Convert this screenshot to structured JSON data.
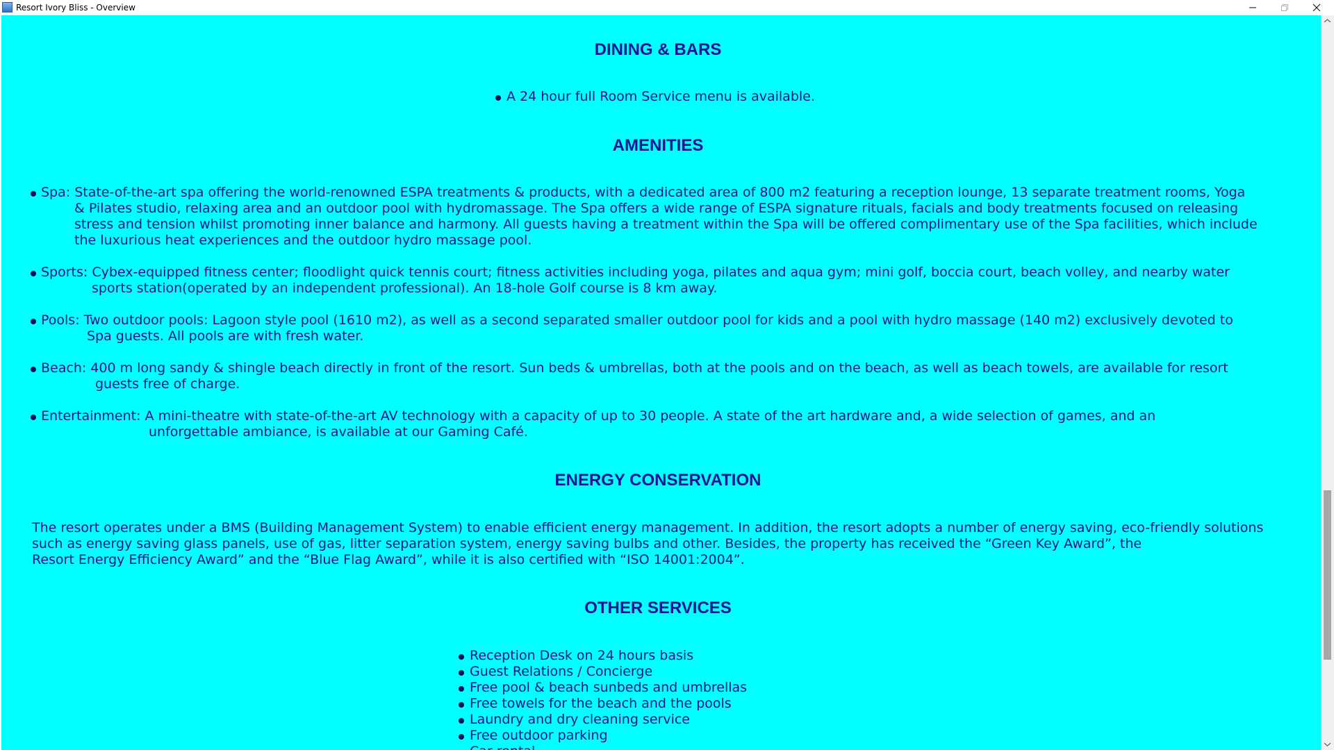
{
  "window": {
    "title": "Resort Ivory Bliss - Overview",
    "background": "#00ffff",
    "text_color": "#1a1a8c"
  },
  "sections": {
    "dining": {
      "heading": "DINING & BARS",
      "item": "A 24 hour full Room Service menu is available."
    },
    "amenities": {
      "heading": "AMENITIES",
      "items": [
        {
          "line1": "Spa: State-of-the-art spa offering the world-renowned ESPA treatments & products, with a dedicated area of 800 m2 featuring a reception lounge, 13 separate treatment rooms, Yoga",
          "line2": "& Pilates studio, relaxing area and an outdoor pool with hydromassage. The Spa offers a wide range of ESPA signature rituals, facials and body treatments focused on releasing",
          "line3": "stress and tension whilst promoting inner balance and harmony. All guests having a treatment within the Spa will be offered complimentary use of the Spa facilities, which include",
          "line4": "the luxurious heat experiences and the outdoor hydro massage pool."
        },
        {
          "line1": "Sports: Cybex-equipped fitness center; floodlight quick tennis court; fitness activities including yoga, pilates and aqua gym; mini golf, boccia court, beach volley, and nearby water",
          "line2": "sports station(operated by an independent professional). An 18-hole Golf course is 8 km away."
        },
        {
          "line1": "Pools: Two outdoor pools: Lagoon style pool (1610 m2), as well as a second separated smaller outdoor pool for kids and a pool with hydro massage (140 m2) exclusively devoted to",
          "line2": "Spa guests. All pools are with fresh water."
        },
        {
          "line1": "Beach: 400 m long sandy & shingle beach directly in front of the resort. Sun beds & umbrellas, both at the pools and on the beach, as well as beach towels, are available for resort",
          "line2": "guests free of charge."
        },
        {
          "line1": "Entertainment: A mini-theatre with state-of-the-art AV technology with a capacity of up to 30 people. A  state of the art hardware and, a wide selection of games, and an",
          "line2": "unforgettable ambiance, is available at our Gaming Café."
        }
      ]
    },
    "energy": {
      "heading": "ENERGY CONSERVATION",
      "line1": "The resort operates under a BMS (Building Management System) to enable efficient energy management. In addition, the resort adopts a number of energy saving, eco-friendly solutions",
      "line2": "such as energy saving glass panels, use of gas, litter separation system, energy saving bulbs and other. Besides, the property has received the “Green Key Award”, the",
      "line3": "Resort Energy Efficiency Award” and the “Blue Flag Award”, while it is also certified with “ISO 14001:2004”."
    },
    "other": {
      "heading": "OTHER SERVICES",
      "items": [
        "Reception Desk on 24 hours basis",
        "Guest Relations / Concierge",
        "Free pool & beach sunbeds and umbrellas",
        "Free towels for the beach and the pools",
        "Laundry and dry cleaning service",
        "Free outdoor parking",
        "Car rental"
      ]
    }
  },
  "scrollbar": {
    "position_fraction": 0.72
  }
}
